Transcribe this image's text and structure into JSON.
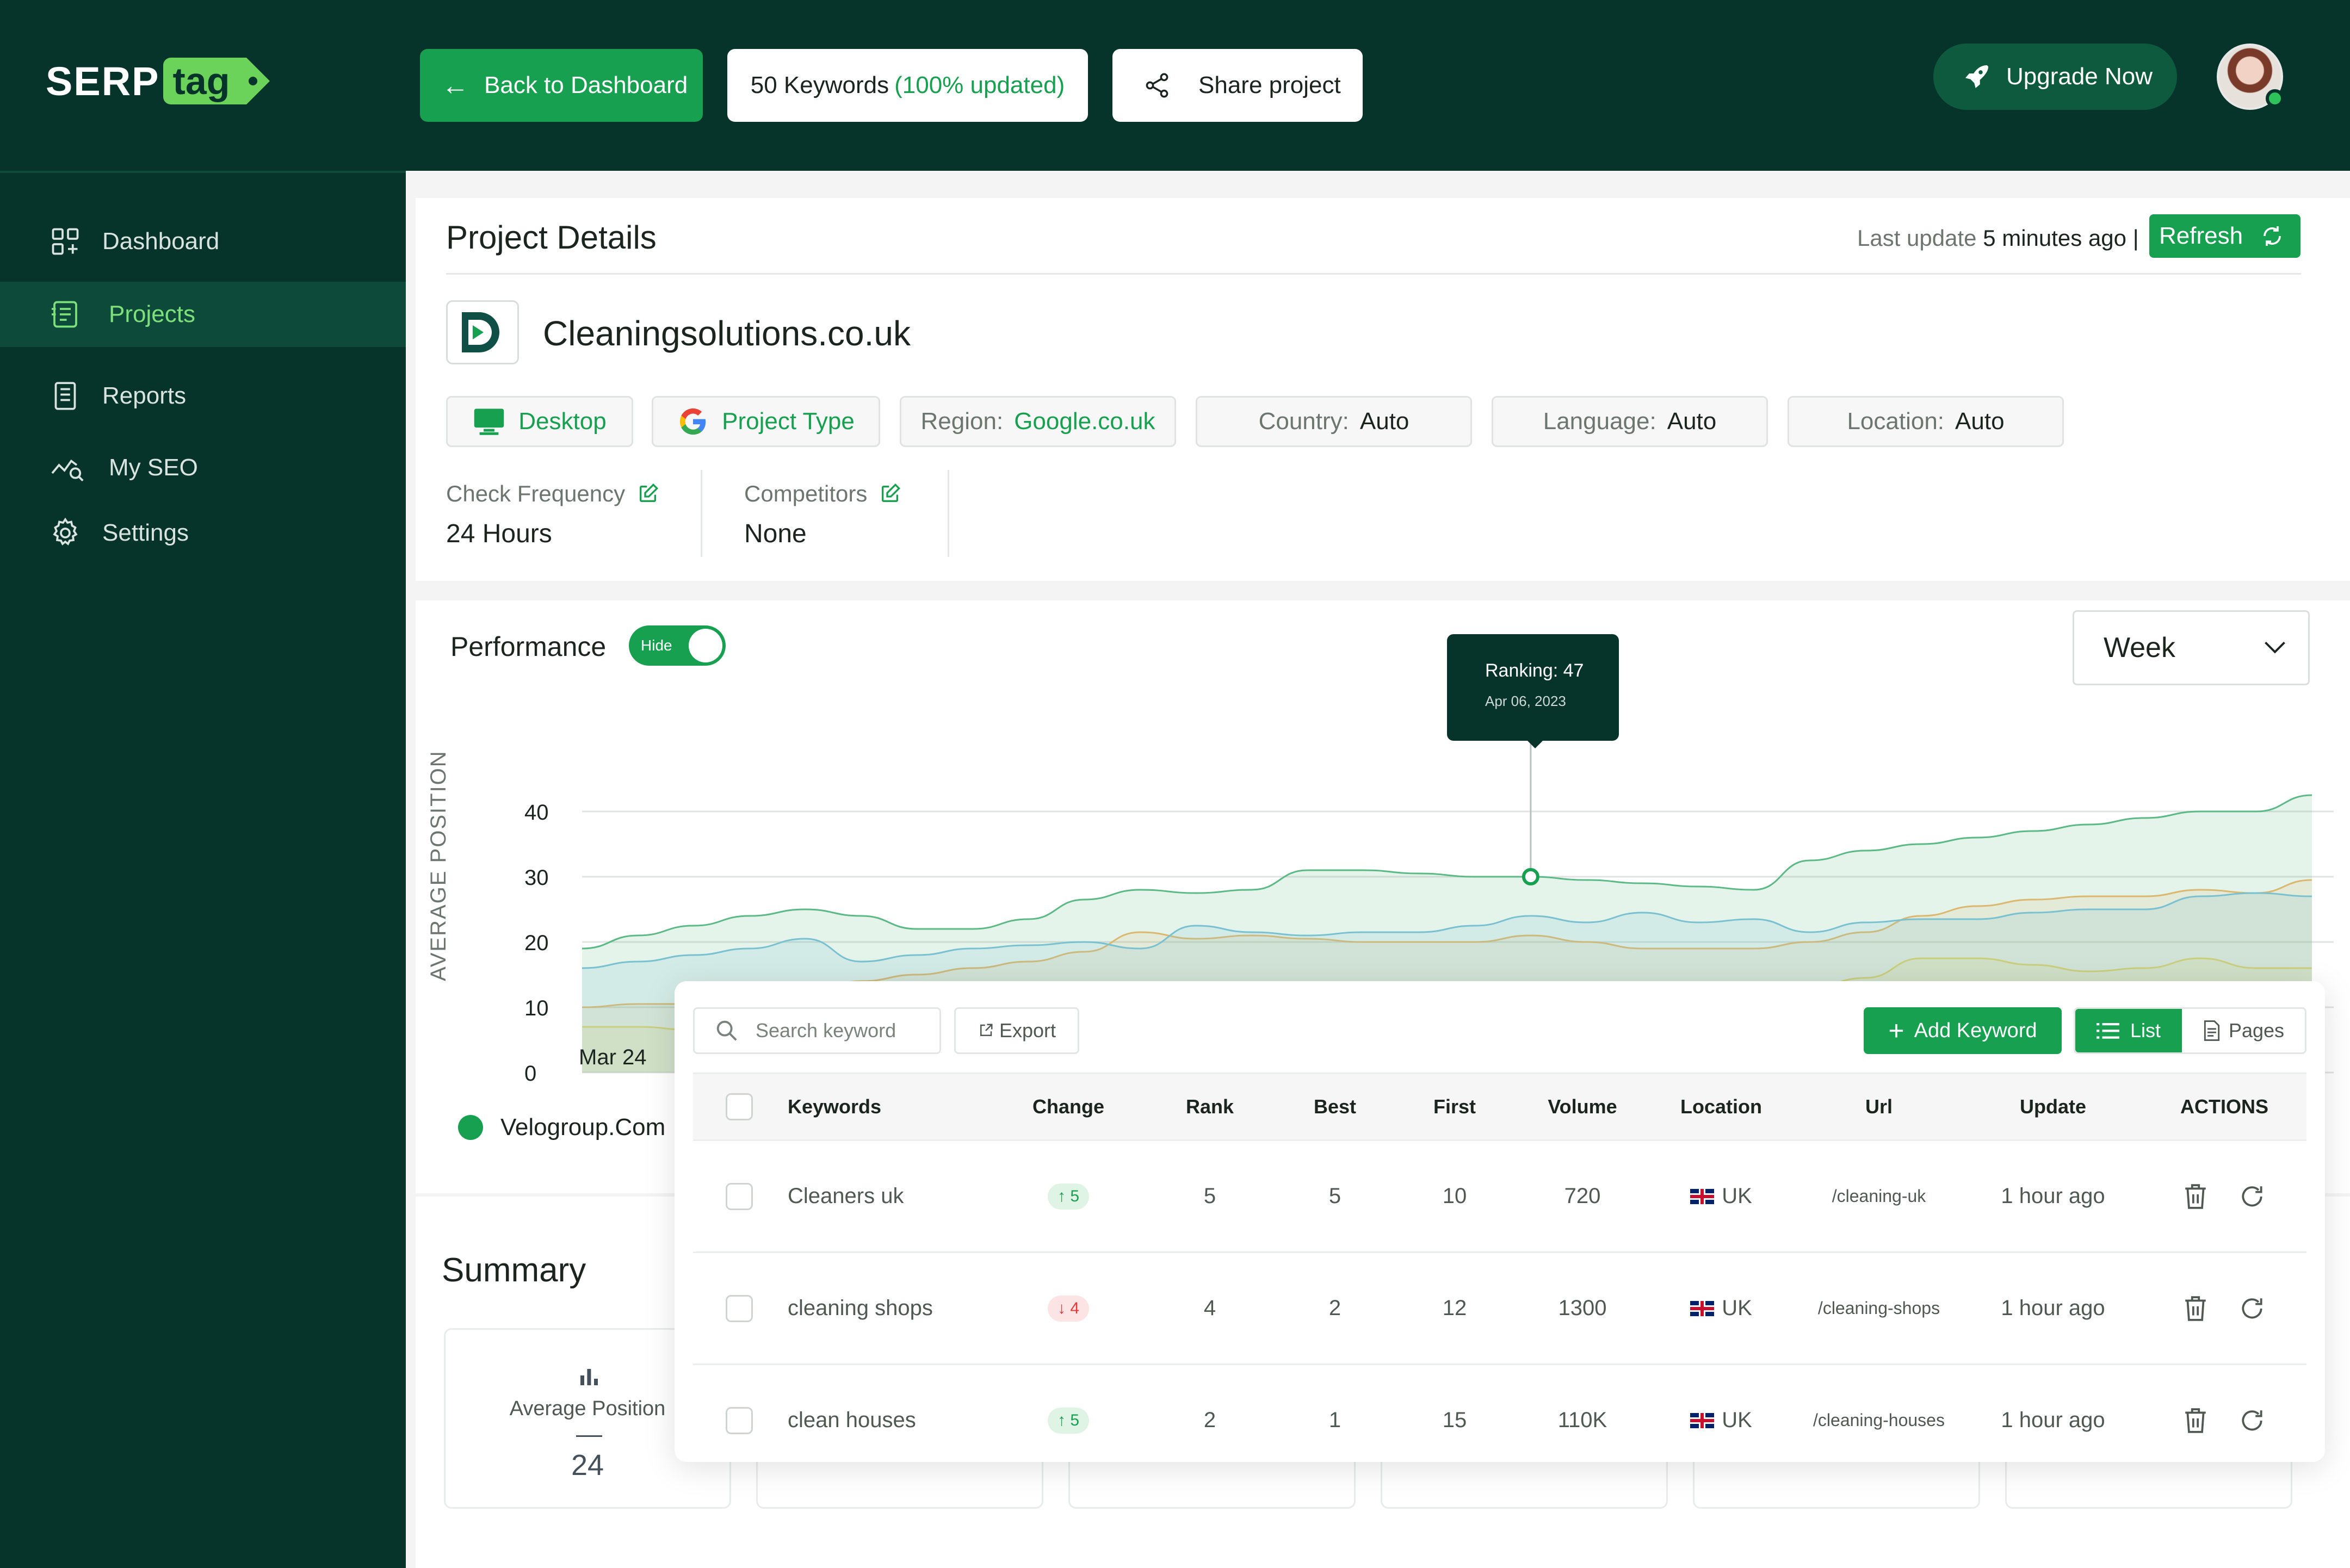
{
  "brand": {
    "logo_main": "SERP",
    "logo_tag": "tag"
  },
  "topbar": {
    "back_label": "Back to Dashboard",
    "keywords_count": "50 Keywords",
    "keywords_status": "(100% updated)",
    "share_label": "Share project",
    "upgrade_label": "Upgrade Now",
    "icons": {
      "back": "arrow-left-icon",
      "share": "share-icon",
      "upgrade": "rocket-icon"
    }
  },
  "sidebar": {
    "items": [
      {
        "label": "Dashboard",
        "icon": "dashboard-grid-icon",
        "active": false
      },
      {
        "label": "Projects",
        "icon": "projects-list-icon",
        "active": true
      },
      {
        "label": "Reports",
        "icon": "reports-document-icon",
        "active": false
      },
      {
        "label": "My SEO",
        "icon": "seo-chart-search-icon",
        "active": false
      },
      {
        "label": "Settings",
        "icon": "gear-icon",
        "active": false
      }
    ]
  },
  "project": {
    "section_title": "Project Details",
    "last_update_label": "Last update",
    "last_update_value": "5 minutes ago",
    "separator": "|",
    "refresh_label": "Refresh",
    "name": "Cleaningsolutions.co.uk",
    "chips": {
      "device": "Desktop",
      "project_type": "Project Type",
      "region_label": "Region:",
      "region_value": "Google.co.uk",
      "country_label": "Country:",
      "country_value": "Auto",
      "language_label": "Language:",
      "language_value": "Auto",
      "location_label": "Location:",
      "location_value": "Auto"
    },
    "check_frequency_label": "Check Frequency",
    "check_frequency_value": "24 Hours",
    "competitors_label": "Competitors",
    "competitors_value": "None"
  },
  "performance": {
    "title": "Performance",
    "toggle_label": "Hide",
    "period": "Week",
    "tooltip": {
      "ranking": "Ranking: 47",
      "date": "Apr 06, 2023"
    },
    "legend": "Velogroup.Com"
  },
  "chart_data": {
    "type": "area",
    "ylabel": "AVERAGE POSITION",
    "ylim": [
      0,
      40
    ],
    "yticks": [
      40,
      30,
      20,
      10,
      0
    ],
    "x_visible_label": "Mar 24",
    "grid": true,
    "series": [
      {
        "name": "Velogroup.Com",
        "color": "#5bb985",
        "values": [
          19,
          21,
          22.5,
          24,
          25,
          24,
          22,
          22,
          23.5,
          26.5,
          28,
          27.5,
          28,
          31,
          31,
          30.5,
          30,
          30,
          29.5,
          29,
          28.5,
          28,
          32.5,
          34,
          35,
          36,
          37,
          38,
          39,
          40,
          40,
          42.5
        ]
      },
      {
        "color": "#7fc3e0",
        "values": [
          16,
          17,
          18,
          19,
          20.5,
          17,
          18,
          19,
          19.5,
          20,
          19,
          22.5,
          21.5,
          21,
          21.5,
          21.5,
          22.5,
          24,
          23,
          24.5,
          23,
          23.5,
          21.5,
          23,
          23.5,
          23.5,
          24.5,
          25,
          25,
          27,
          27.5,
          27
        ]
      },
      {
        "color": "#f3b86b",
        "values": [
          10,
          10.5,
          10.5,
          10,
          12,
          14,
          15,
          16,
          17,
          18.5,
          21.5,
          20.5,
          21,
          20.5,
          20,
          20,
          20,
          21,
          20,
          19,
          19,
          19,
          20,
          21.5,
          24,
          25.5,
          26.5,
          27,
          27,
          28,
          27.5,
          29.5
        ]
      },
      {
        "color": "#f2dc6b",
        "values": [
          7,
          7,
          6.5,
          7,
          8,
          9.5,
          10,
          9,
          8.5,
          9.5,
          10,
          10.5,
          11,
          9.5,
          10,
          10.5,
          11,
          12,
          11.5,
          11,
          12,
          12.5,
          13,
          14.5,
          17.5,
          17.5,
          16.5,
          15.5,
          16,
          17.5,
          16,
          16
        ]
      }
    ]
  },
  "summary": {
    "title": "Summary",
    "average_position_label": "Average Position",
    "average_position_value": "24",
    "icon": "bar-chart-icon"
  },
  "keywords": {
    "search_placeholder": "Search keyword",
    "export_label": "Export",
    "add_label": "Add Keyword",
    "list_label": "List",
    "pages_label": "Pages",
    "columns": [
      "Keywords",
      "Change",
      "Rank",
      "Best",
      "First",
      "Volume",
      "Location",
      "Url",
      "Update",
      "ACTIONS"
    ],
    "rows": [
      {
        "keyword": "Cleaners uk",
        "change": "5",
        "direction": "up",
        "rank": "5",
        "best": "5",
        "first": "10",
        "volume": "720",
        "location": "UK",
        "url": "/cleaning-uk",
        "update": "1 hour ago"
      },
      {
        "keyword": "cleaning shops",
        "change": "4",
        "direction": "down",
        "rank": "4",
        "best": "2",
        "first": "12",
        "volume": "1300",
        "location": "UK",
        "url": "/cleaning-shops",
        "update": "1 hour ago"
      },
      {
        "keyword": "clean houses",
        "change": "5",
        "direction": "up",
        "rank": "2",
        "best": "1",
        "first": "15",
        "volume": "110K",
        "location": "UK",
        "url": "/cleaning-houses",
        "update": "1 hour ago"
      }
    ]
  }
}
